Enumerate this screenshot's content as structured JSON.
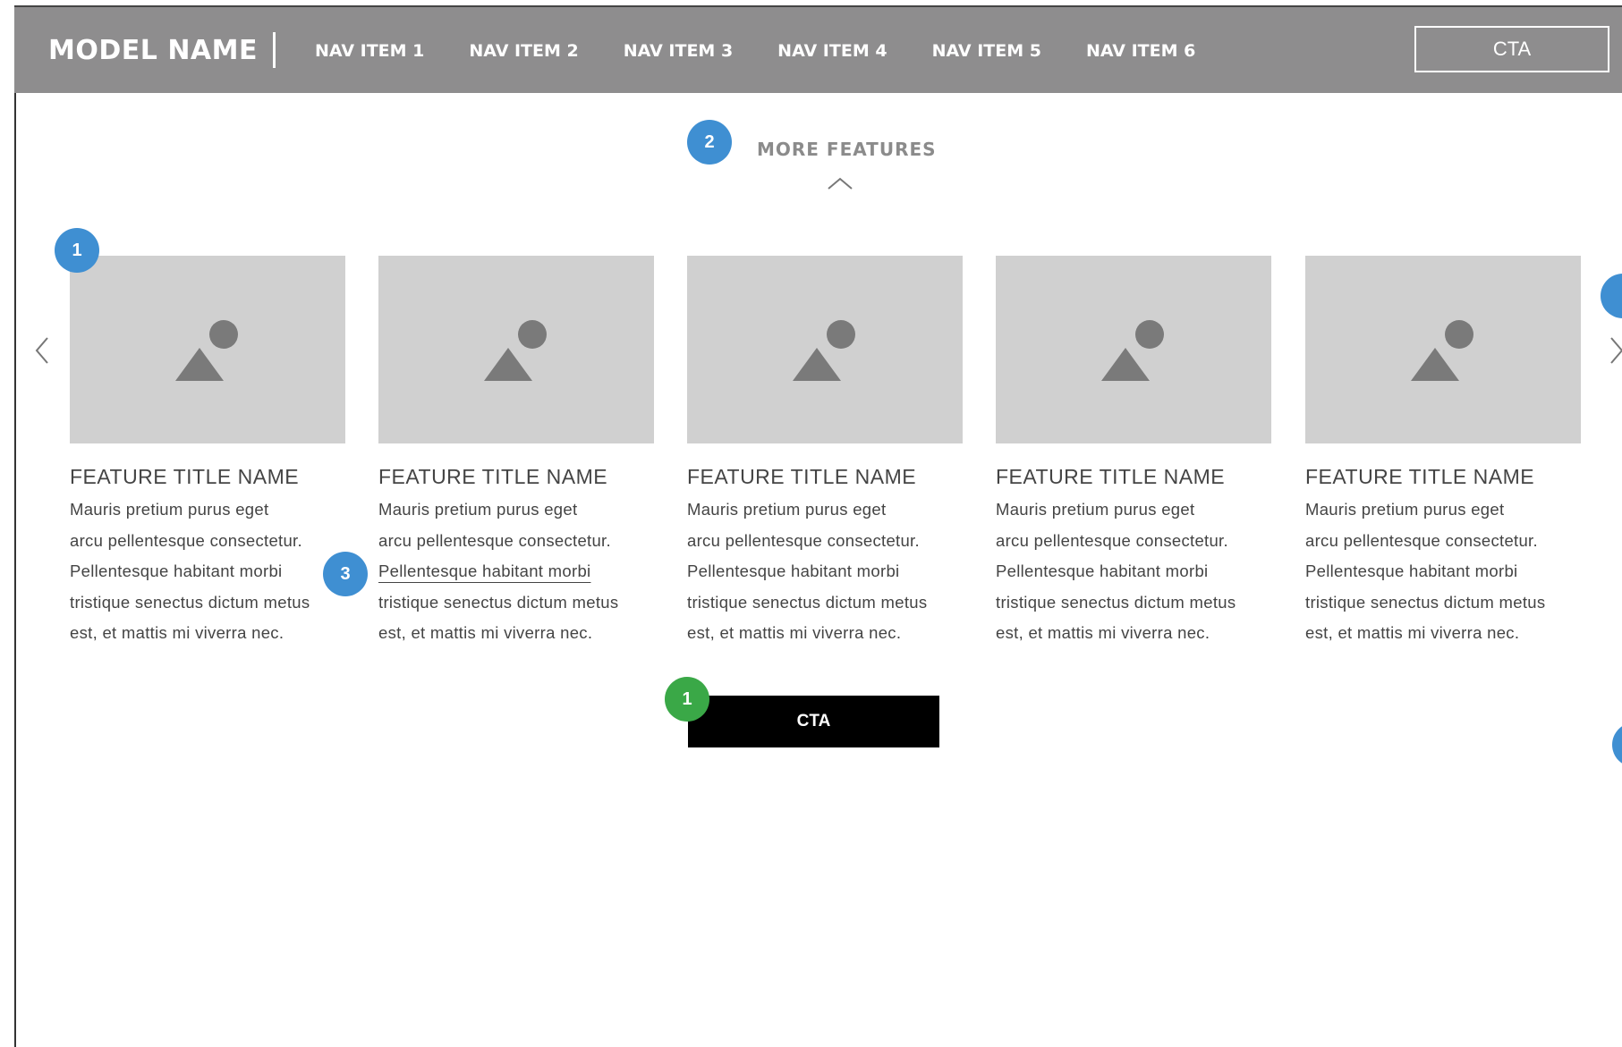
{
  "header": {
    "brand": "MODEL NAME",
    "nav_items": [
      "NAV ITEM 1",
      "NAV ITEM 2",
      "NAV ITEM 3",
      "NAV ITEM 4",
      "NAV ITEM 5",
      "NAV ITEM 6"
    ],
    "cta_label": "CTA"
  },
  "section": {
    "heading": "MORE FEATURES"
  },
  "annotations": {
    "badge_more_features": "2",
    "badge_carousel": "1",
    "badge_link": "3",
    "badge_cta": "1"
  },
  "cards": [
    {
      "title": "FEATURE TITLE NAME",
      "body_lines": [
        "Mauris pretium purus eget",
        "arcu pellentesque consectetur.",
        "Pellentesque habitant morbi",
        "tristique senectus dictum metus",
        "est, et mattis mi viverra nec."
      ]
    },
    {
      "title": "FEATURE TITLE NAME",
      "body_lines": [
        "Mauris pretium purus eget",
        "arcu pellentesque consectetur.",
        "Pellentesque habitant morbi",
        "tristique senectus dictum metus",
        "est, et mattis mi viverra nec."
      ]
    },
    {
      "title": "FEATURE TITLE NAME",
      "body_lines": [
        "Mauris pretium purus eget",
        "arcu pellentesque consectetur.",
        "Pellentesque habitant morbi",
        "tristique senectus dictum metus",
        "est, et mattis mi viverra nec."
      ]
    },
    {
      "title": "FEATURE TITLE NAME",
      "body_lines": [
        "Mauris pretium purus eget",
        "arcu pellentesque consectetur.",
        "Pellentesque habitant morbi",
        "tristique senectus dictum metus",
        "est, et mattis mi viverra nec."
      ]
    },
    {
      "title": "FEATURE TITLE NAME",
      "body_lines": [
        "Mauris pretium purus eget",
        "arcu pellentesque consectetur.",
        "Pellentesque habitant morbi",
        "tristique senectus dictum metus",
        "est, et mattis mi viverra nec."
      ]
    }
  ],
  "main_cta_label": "CTA",
  "icons": {
    "carousel_prev": "chevron-left-icon",
    "carousel_next": "chevron-right-icon",
    "collapse": "chevron-up-icon",
    "image_placeholder": "image-placeholder-icon"
  },
  "colors": {
    "header_bg": "#8e8d8e",
    "annotation_blue": "#3f8fd2",
    "annotation_green": "#3aa847",
    "cta_bg": "#000000",
    "image_placeholder_bg": "#d0d0d0"
  }
}
